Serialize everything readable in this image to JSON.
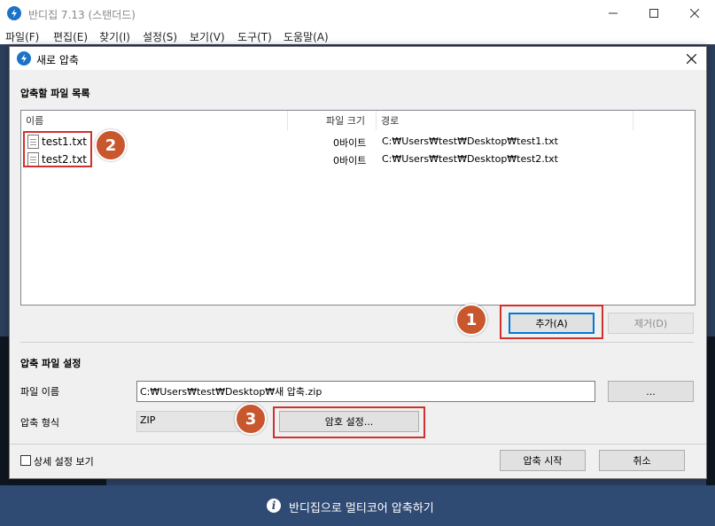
{
  "app": {
    "title": "반디집 7.13 (스탠더드)",
    "menu": [
      "파일(F)",
      "편집(E)",
      "찾기(I)",
      "설정(S)",
      "보기(V)",
      "도구(T)",
      "도움말(A)"
    ],
    "status_text": "반디집으로 멀티코어 압축하기"
  },
  "dialog": {
    "title": "새로 압축",
    "files_section_label": "압축할 파일 목록",
    "columns": {
      "name": "이름",
      "size": "파일 크기",
      "path": "경로"
    },
    "files": [
      {
        "name": "test1.txt",
        "size": "0바이트",
        "path": "C:₩Users₩test₩Desktop₩test1.txt"
      },
      {
        "name": "test2.txt",
        "size": "0바이트",
        "path": "C:₩Users₩test₩Desktop₩test2.txt"
      }
    ],
    "add_button": "추가(A)",
    "remove_button": "제거(D)",
    "settings_section_label": "압축 파일 설정",
    "filename_label": "파일 이름",
    "filename_value": "C:₩Users₩test₩Desktop₩새 압축.zip",
    "browse_button": "...",
    "format_label": "압축 형식",
    "format_value": "ZIP",
    "password_button": "암호 설정...",
    "advanced_checkbox_label": "상세 설정 보기",
    "start_button": "압축 시작",
    "cancel_button": "취소"
  },
  "annotations": {
    "badge1": "1",
    "badge2": "2",
    "badge3": "3"
  },
  "colors": {
    "accent": "#0078d7",
    "highlight_red": "#d0312d",
    "badge": "#c8572e",
    "status_bar": "#2f4a73"
  }
}
